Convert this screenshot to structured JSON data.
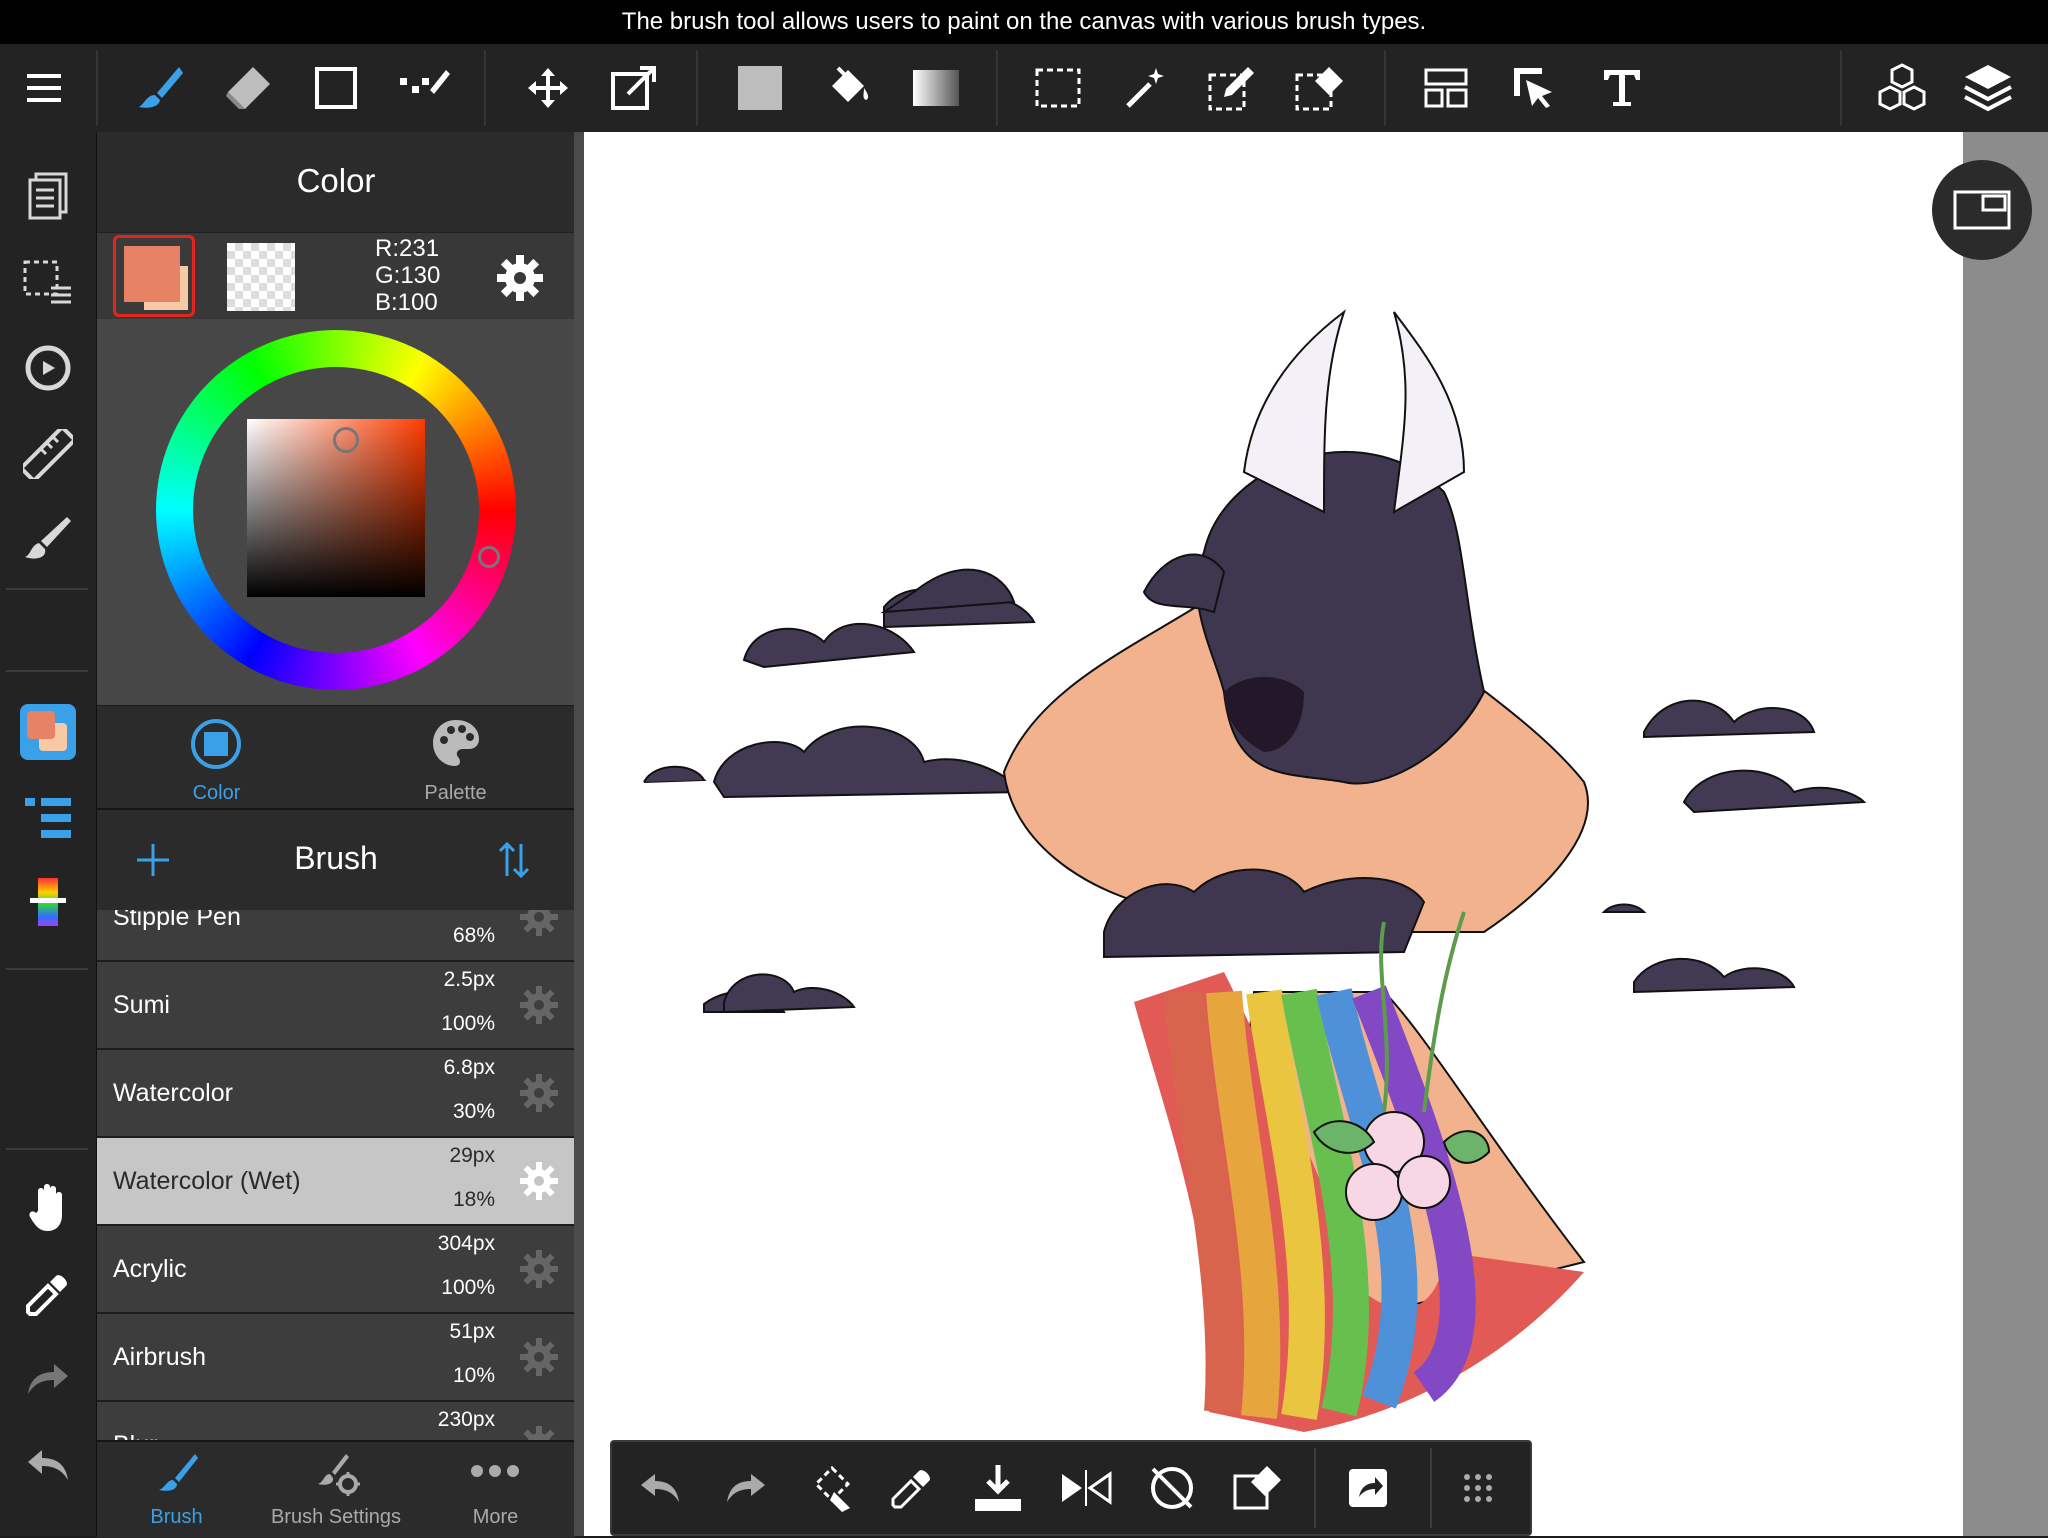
{
  "caption": "The brush tool allows users to paint on the canvas with various brush types.",
  "colors": {
    "accent": "#3aa0e8",
    "main_color": "#e78264",
    "sub_color": "#f7c9a6",
    "panel_bg": "#2b2b2b",
    "selected_row_bg": "#c6c6c6"
  },
  "toolbar": {
    "icons": [
      "menu-icon",
      "brush-icon",
      "eraser-icon",
      "shape-icon",
      "dot-brush-icon",
      "move-icon",
      "transform-icon",
      "fill-color-icon",
      "bucket-icon",
      "gradient-icon",
      "select-rect-icon",
      "magic-wand-icon",
      "select-pen-icon",
      "select-eraser-icon",
      "layout-icon",
      "operation-icon",
      "text-icon",
      "3d-icon",
      "layers-icon"
    ]
  },
  "leftbar": {
    "icons": [
      "pages-icon",
      "selection-list-icon",
      "snap-icon",
      "ruler-icon",
      "brush-adjust-icon",
      "color-panel-icon",
      "layer-list-icon",
      "color-bar-icon",
      "hand-icon",
      "eyedropper-icon",
      "redo-icon",
      "undo-icon"
    ]
  },
  "color_panel": {
    "title": "Color",
    "rgb": {
      "r": "R:231",
      "g": "G:130",
      "b": "B:100"
    },
    "tabs": [
      {
        "label": "Color",
        "active": true
      },
      {
        "label": "Palette",
        "active": false
      }
    ]
  },
  "brush_panel": {
    "title": "Brush",
    "items": [
      {
        "name": "Stipple Pen",
        "size": "",
        "opacity": "68%"
      },
      {
        "name": "Sumi",
        "size": "2.5px",
        "opacity": "100%"
      },
      {
        "name": "Watercolor",
        "size": "6.8px",
        "opacity": "30%"
      },
      {
        "name": "Watercolor (Wet)",
        "size": "29px",
        "opacity": "18%",
        "selected": true
      },
      {
        "name": "Acrylic",
        "size": "304px",
        "opacity": "100%"
      },
      {
        "name": "Airbrush",
        "size": "51px",
        "opacity": "10%"
      },
      {
        "name": "Blur",
        "size": "230px",
        "opacity": ""
      }
    ]
  },
  "bottom_tabs": [
    {
      "label": "Brush",
      "active": true
    },
    {
      "label": "Brush Settings",
      "active": false
    },
    {
      "label": "More",
      "active": false
    }
  ],
  "bottom_bar": {
    "icons": [
      "undo-icon",
      "redo-icon",
      "rotate-canvas-icon",
      "eyedropper-icon",
      "save-icon",
      "flip-icon",
      "reset-rotation-icon",
      "clear-icon",
      "share-icon",
      "grid-menu-icon"
    ]
  }
}
